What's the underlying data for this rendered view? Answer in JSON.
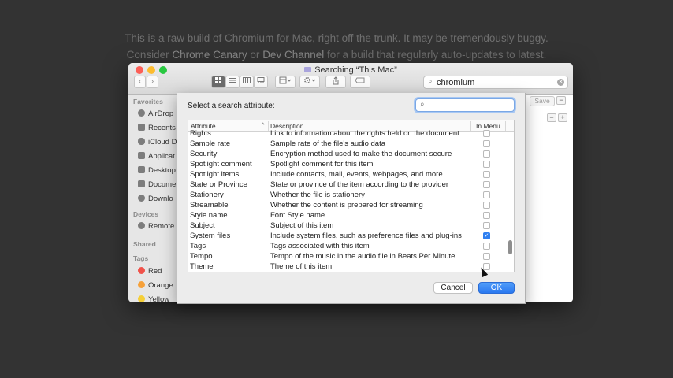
{
  "background": {
    "line1": "This is a raw build of Chromium for Mac, right off the trunk. It may be tremendously buggy.",
    "line2_pre": "Consider ",
    "link_canary": "Chrome Canary",
    "line2_mid": " or ",
    "link_dev": "Dev Channel",
    "line2_post": " for a build that regularly auto-updates to latest."
  },
  "window": {
    "title": "Searching “This Mac”",
    "search_value": "chromium",
    "save_label": "Save"
  },
  "sidebar": {
    "favorites_header": "Favorites",
    "favorites": [
      "AirDrop",
      "Recents",
      "iCloud D",
      "Applicat",
      "Desktop",
      "Docume",
      "Downlo"
    ],
    "devices_header": "Devices",
    "devices": [
      "Remote"
    ],
    "shared_header": "Shared",
    "tags_header": "Tags",
    "tags": [
      {
        "label": "Red",
        "color": "#f0524a"
      },
      {
        "label": "Orange",
        "color": "#f6a13a"
      },
      {
        "label": "Yellow",
        "color": "#f5cf38"
      }
    ]
  },
  "dialog": {
    "label": "Select a search attribute:",
    "search_placeholder": "",
    "columns": [
      "Attribute",
      "Description",
      "In Menu"
    ],
    "rows": [
      {
        "attribute": "Rights",
        "description": "Link to information about the rights held on the document",
        "in_menu": false
      },
      {
        "attribute": "Sample rate",
        "description": "Sample rate of the file's audio data",
        "in_menu": false
      },
      {
        "attribute": "Security",
        "description": "Encryption method used to make the document secure",
        "in_menu": false
      },
      {
        "attribute": "Spotlight comment",
        "description": "Spotlight comment for this item",
        "in_menu": false
      },
      {
        "attribute": "Spotlight items",
        "description": "Include contacts, mail, events, webpages, and more",
        "in_menu": false
      },
      {
        "attribute": "State or Province",
        "description": "State or province of the item according to the provider",
        "in_menu": false
      },
      {
        "attribute": "Stationery",
        "description": "Whether the file is stationery",
        "in_menu": false
      },
      {
        "attribute": "Streamable",
        "description": "Whether the content is prepared for streaming",
        "in_menu": false
      },
      {
        "attribute": "Style name",
        "description": "Font Style name",
        "in_menu": false
      },
      {
        "attribute": "Subject",
        "description": "Subject of this item",
        "in_menu": false
      },
      {
        "attribute": "System files",
        "description": "Include system files, such as preference files and plug-ins",
        "in_menu": true
      },
      {
        "attribute": "Tags",
        "description": "Tags associated with this item",
        "in_menu": false
      },
      {
        "attribute": "Tempo",
        "description": "Tempo of the music in the audio file in Beats Per Minute",
        "in_menu": false
      },
      {
        "attribute": "Theme",
        "description": "Theme of this item",
        "in_menu": false
      }
    ],
    "cancel_label": "Cancel",
    "ok_label": "OK"
  },
  "icons": {
    "checkmark": "✓",
    "search": "⌕",
    "sort_indicator": "^"
  },
  "colors": {
    "accent": "#2f7ff0",
    "background": "#333333"
  }
}
